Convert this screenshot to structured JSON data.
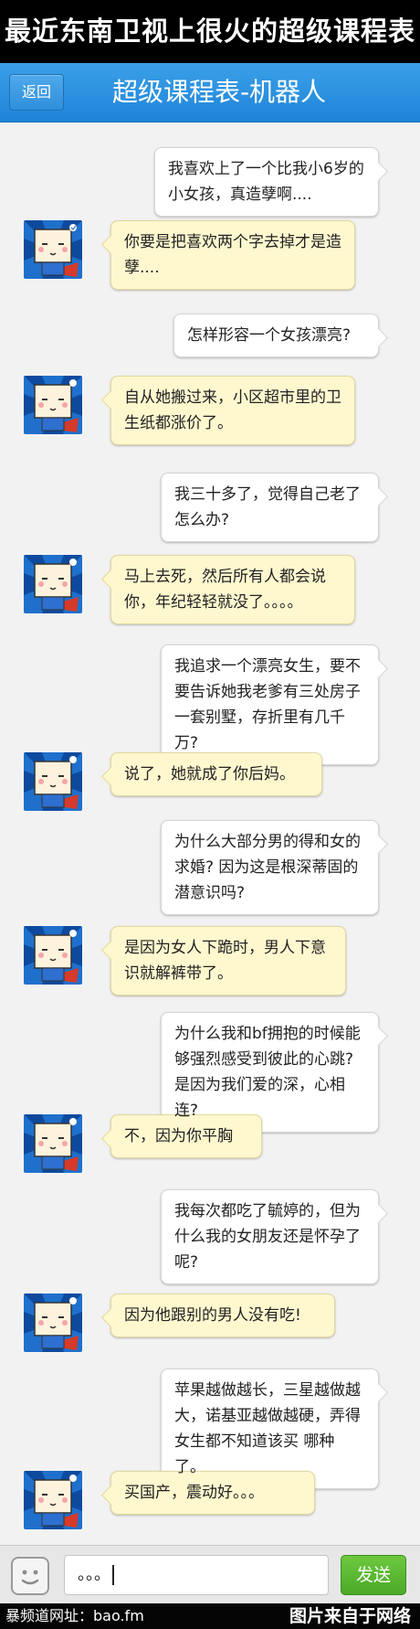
{
  "banner": {
    "title": "最近东南卫视上很火的超级课程表"
  },
  "navbar": {
    "back_label": "返回",
    "title": "超级课程表-机器人"
  },
  "messages": [
    {
      "side": "me",
      "text": "我喜欢上了一个比我小6岁的小女孩，真造孽啊...."
    },
    {
      "side": "bot",
      "text": "你要是把喜欢两个字去掉才是造孽...."
    },
    {
      "side": "me",
      "text": "怎样形容一个女孩漂亮?"
    },
    {
      "side": "bot",
      "text": "自从她搬过来，小区超市里的卫生纸都涨价了。"
    },
    {
      "side": "me",
      "text": "我三十多了，觉得自己老了怎么办?"
    },
    {
      "side": "bot",
      "text": "马上去死，然后所有人都会说你，年纪轻轻就没了。。。。"
    },
    {
      "side": "me",
      "text": "我追求一个漂亮女生，要不要告诉她我老爹有三处房子一套别墅，存折里有几千万?"
    },
    {
      "side": "bot",
      "text": "说了，她就成了你后妈。"
    },
    {
      "side": "me",
      "text": "为什么大部分男的得和女的求婚? 因为这是根深蒂固的潜意识吗?"
    },
    {
      "side": "bot",
      "text": "是因为女人下跪时，男人下意识就解裤带了。"
    },
    {
      "side": "me",
      "text": "为什么我和bf拥抱的时候能够强烈感受到彼此的心跳? 是因为我们爱的深，心相连?"
    },
    {
      "side": "bot",
      "text": "不，因为你平胸"
    },
    {
      "side": "me",
      "text": "我每次都吃了毓婷的，但为什么我的女朋友还是怀孕了呢?"
    },
    {
      "side": "bot",
      "text": "因为他跟别的男人没有吃!"
    },
    {
      "side": "me",
      "text": "苹果越做越长，三星越做越大，诺基亚越做越硬，弄得女生都不知道该买 哪种了。"
    },
    {
      "side": "bot",
      "text": "买国产，震动好。。。"
    }
  ],
  "input_bar": {
    "input_value": "。。。",
    "send_label": "发送"
  },
  "footer": {
    "left": "暴频道网址：bao.fm",
    "right": "图片来自于网络"
  },
  "colors": {
    "navbar": "#2a8fdf",
    "bot_bubble": "#fff8cf",
    "send": "#58b52e"
  }
}
